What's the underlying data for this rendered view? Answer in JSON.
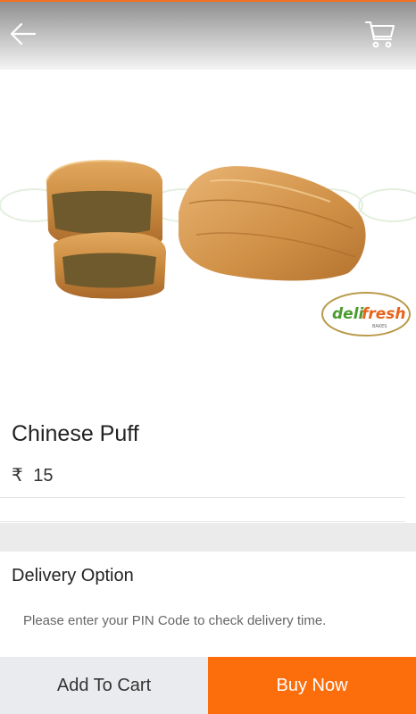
{
  "header": {
    "back_icon": "arrow-left-icon",
    "cart_icon": "cart-icon"
  },
  "product": {
    "image_icon": "product-photo",
    "watermark_brand": "delifresh",
    "watermark_sub": "BAKES",
    "title": "Chinese Puff",
    "currency_symbol": "₹",
    "price": "15"
  },
  "delivery": {
    "title": "Delivery Option",
    "note": "Please enter your PIN Code to check delivery time."
  },
  "actions": {
    "add_to_cart_label": "Add To Cart",
    "buy_now_label": "Buy Now"
  },
  "colors": {
    "accent": "#fc6d0c",
    "logo_green": "#4a9b2f",
    "logo_orange": "#e8621a"
  }
}
